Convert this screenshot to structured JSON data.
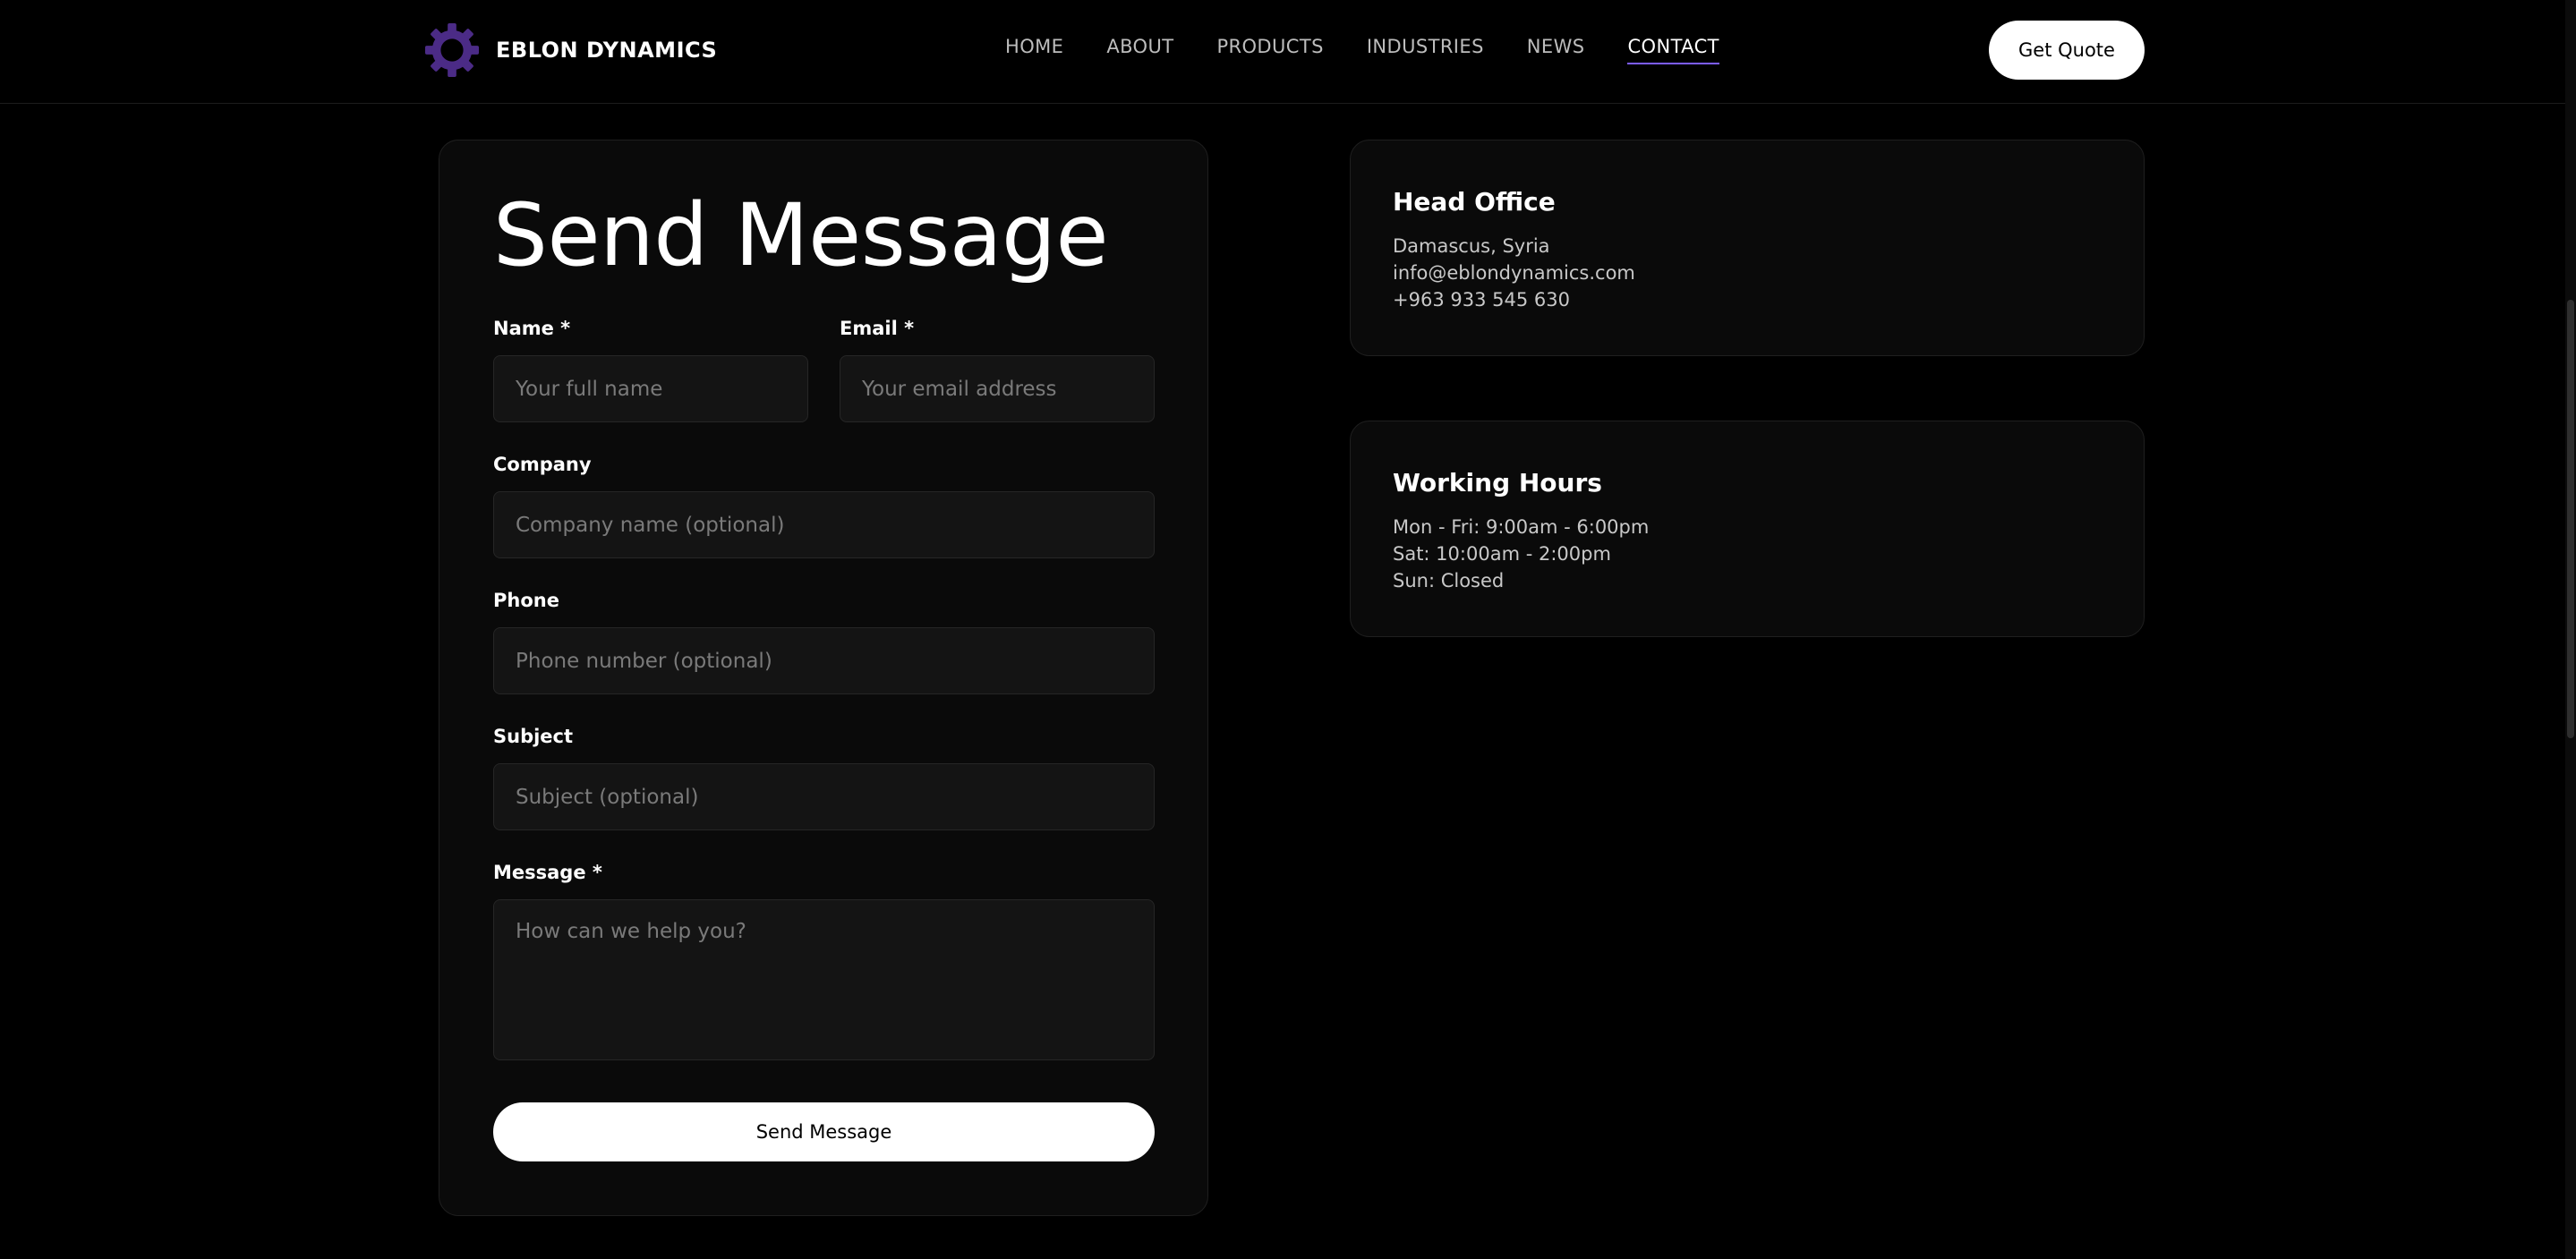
{
  "header": {
    "brand_name": "EBLON DYNAMICS",
    "logo_icon": "gear-icon",
    "logo_color": "#4b2b86",
    "nav": [
      {
        "label": "HOME"
      },
      {
        "label": "ABOUT"
      },
      {
        "label": "PRODUCTS"
      },
      {
        "label": "INDUSTRIES"
      },
      {
        "label": "NEWS"
      },
      {
        "label": "CONTACT",
        "active": true
      }
    ],
    "quote_button": "Get Quote"
  },
  "form": {
    "title": "Send Message",
    "name": {
      "label": "Name *",
      "placeholder": "Your full name",
      "value": ""
    },
    "email": {
      "label": "Email *",
      "placeholder": "Your email address",
      "value": ""
    },
    "company": {
      "label": "Company",
      "placeholder": "Company name (optional)",
      "value": ""
    },
    "phone": {
      "label": "Phone",
      "placeholder": "Phone number (optional)",
      "value": ""
    },
    "subject": {
      "label": "Subject",
      "placeholder": "Subject (optional)",
      "value": ""
    },
    "message": {
      "label": "Message *",
      "placeholder": "How can we help you?",
      "value": ""
    },
    "submit_label": "Send Message"
  },
  "head_office": {
    "title": "Head Office",
    "lines": [
      "Damascus, Syria",
      "info@eblondynamics.com",
      "+963 933 545 630"
    ]
  },
  "working_hours": {
    "title": "Working Hours",
    "lines": [
      "Mon - Fri: 9:00am - 6:00pm",
      "Sat: 10:00am - 2:00pm",
      "Sun: Closed"
    ]
  },
  "colors": {
    "background": "#000000",
    "card": "#0a0a0a",
    "input": "#141414",
    "accent": "#7b5cff",
    "button": "#ffffff"
  }
}
